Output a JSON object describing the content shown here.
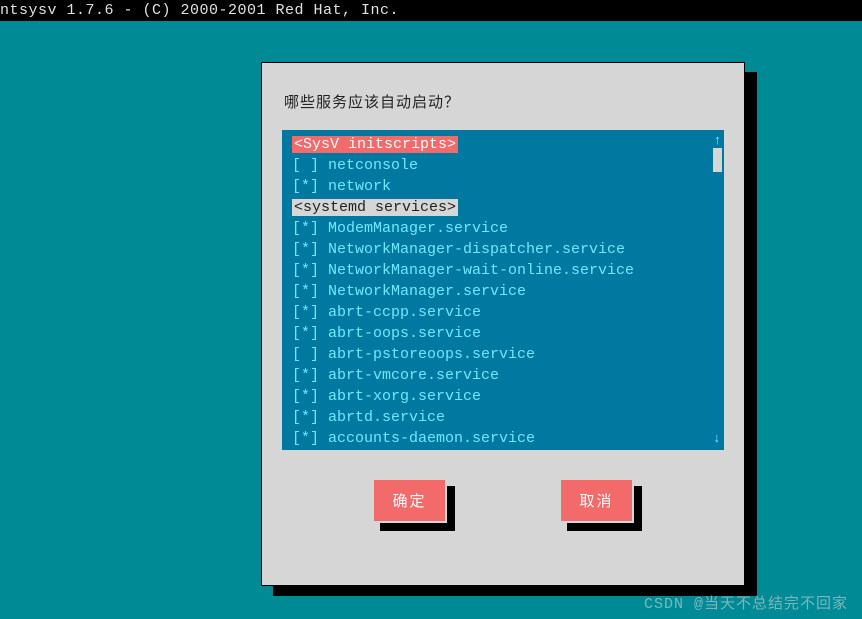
{
  "title_bar": "ntsysv 1.7.6 - (C) 2000-2001 Red Hat, Inc.",
  "dialog": {
    "prompt": "哪些服务应该自动启动？",
    "sections": [
      {
        "header": "<SysV initscripts>",
        "header_style": "highlight",
        "items": [
          {
            "checked": false,
            "label": "netconsole"
          },
          {
            "checked": true,
            "label": "network"
          }
        ]
      },
      {
        "header": "<systemd services>",
        "header_style": "alt",
        "items": [
          {
            "checked": true,
            "label": "ModemManager.service"
          },
          {
            "checked": true,
            "label": "NetworkManager-dispatcher.service"
          },
          {
            "checked": true,
            "label": "NetworkManager-wait-online.service"
          },
          {
            "checked": true,
            "label": "NetworkManager.service"
          },
          {
            "checked": true,
            "label": "abrt-ccpp.service"
          },
          {
            "checked": true,
            "label": "abrt-oops.service"
          },
          {
            "checked": false,
            "label": "abrt-pstoreoops.service"
          },
          {
            "checked": true,
            "label": "abrt-vmcore.service"
          },
          {
            "checked": true,
            "label": "abrt-xorg.service"
          },
          {
            "checked": true,
            "label": "abrtd.service"
          },
          {
            "checked": true,
            "label": "accounts-daemon.service"
          }
        ]
      }
    ],
    "buttons": {
      "ok": "确定",
      "cancel": "取消"
    }
  },
  "watermark": "CSDN @当天不总结完不回家"
}
